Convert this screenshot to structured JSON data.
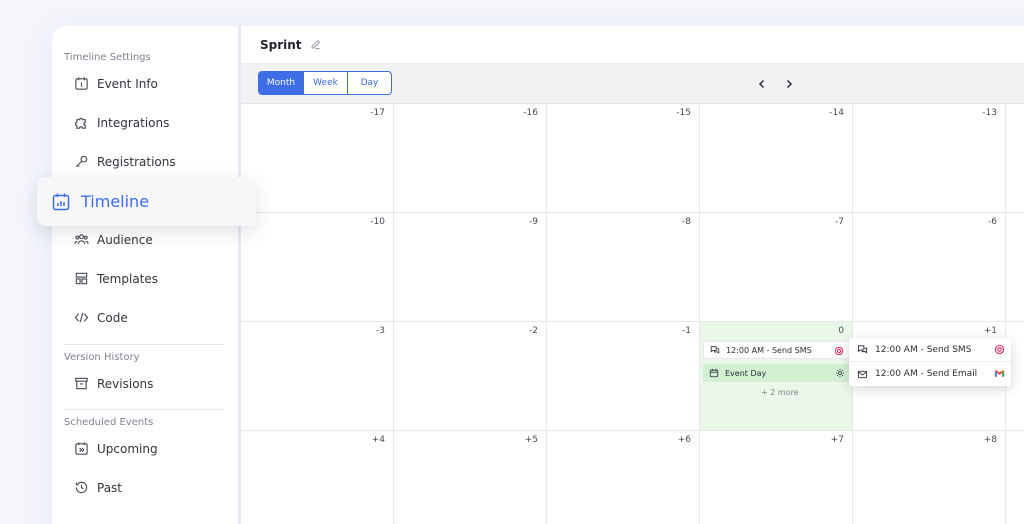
{
  "sidebar": {
    "sections": [
      {
        "title": "Timeline Settings"
      },
      {
        "title": "Version History"
      },
      {
        "title": "Scheduled Events"
      }
    ],
    "items": [
      {
        "label": "Event Info",
        "icon": "calendar-info-icon"
      },
      {
        "label": "Integrations",
        "icon": "puzzle-icon"
      },
      {
        "label": "Registrations",
        "icon": "key-icon"
      },
      {
        "label": "Timeline",
        "icon": "calendar-chart-icon",
        "active": true
      },
      {
        "label": "Audience",
        "icon": "people-icon"
      },
      {
        "label": "Templates",
        "icon": "templates-icon"
      },
      {
        "label": "Code",
        "icon": "code-icon"
      },
      {
        "label": "Revisions",
        "icon": "archive-icon"
      },
      {
        "label": "Upcoming",
        "icon": "calendar-forward-icon"
      },
      {
        "label": "Past",
        "icon": "history-icon"
      }
    ]
  },
  "header": {
    "title": "Sprint"
  },
  "toolbar": {
    "views": [
      "Month",
      "Week",
      "Day"
    ],
    "active_view": "Month",
    "prev_label": "‹",
    "next_label": "›"
  },
  "calendar": {
    "rows": [
      [
        "-17",
        "-16",
        "-15",
        "-14",
        "-13"
      ],
      [
        "-10",
        "-9",
        "-8",
        "-7",
        "-6"
      ],
      [
        "-3",
        "-2",
        "-1",
        "0",
        "+1"
      ],
      [
        "+4",
        "+5",
        "+6",
        "+7",
        "+8"
      ]
    ],
    "events": {
      "sms": "12:00 AM - Send SMS",
      "event_day": "Event Day",
      "more": "+ 2 more"
    },
    "popup": [
      {
        "label": "12:00 AM - Send SMS"
      },
      {
        "label": "12:00 AM - Send Email"
      }
    ]
  },
  "colors": {
    "accent": "#3d6ee6",
    "highlight": "#eaf8ea",
    "sms_icon": "#e0245e"
  }
}
